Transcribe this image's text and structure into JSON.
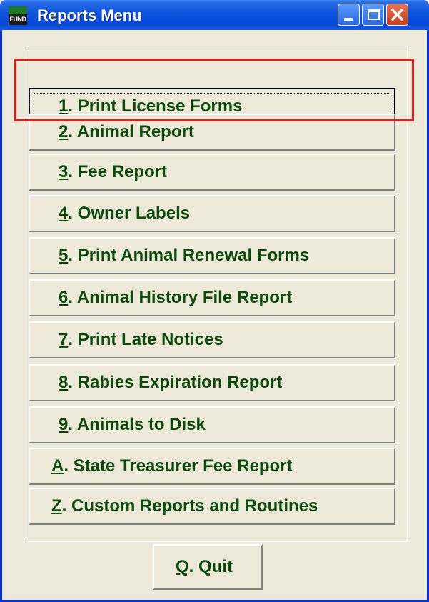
{
  "window": {
    "title": "Reports Menu",
    "app_icon_text": "FUND"
  },
  "menu": {
    "items": [
      {
        "key": "1",
        "rest": ".  Print License Forms"
      },
      {
        "key": "2",
        "rest": ".  Animal Report"
      },
      {
        "key": "3",
        "rest": ".  Fee Report"
      },
      {
        "key": "4",
        "rest": ".  Owner Labels"
      },
      {
        "key": "5",
        "rest": ". Print Animal Renewal Forms"
      },
      {
        "key": "6",
        "rest": ". Animal History File Report"
      },
      {
        "key": "7",
        "rest": ".  Print Late Notices"
      },
      {
        "key": "8",
        "rest": ". Rabies Expiration Report"
      },
      {
        "key": "9",
        "rest": ".  Animals to Disk"
      },
      {
        "key": "A",
        "rest": ". State Treasurer Fee Report"
      },
      {
        "key": "Z",
        "rest": ". Custom Reports and Routines"
      }
    ],
    "quit": {
      "key": "Q",
      "rest": ".  Quit"
    }
  },
  "colors": {
    "title_bar": "#0A53DE",
    "button_text": "#0C4A0C",
    "highlight_box": "#E61B1B",
    "face": "#ECE9D8"
  }
}
